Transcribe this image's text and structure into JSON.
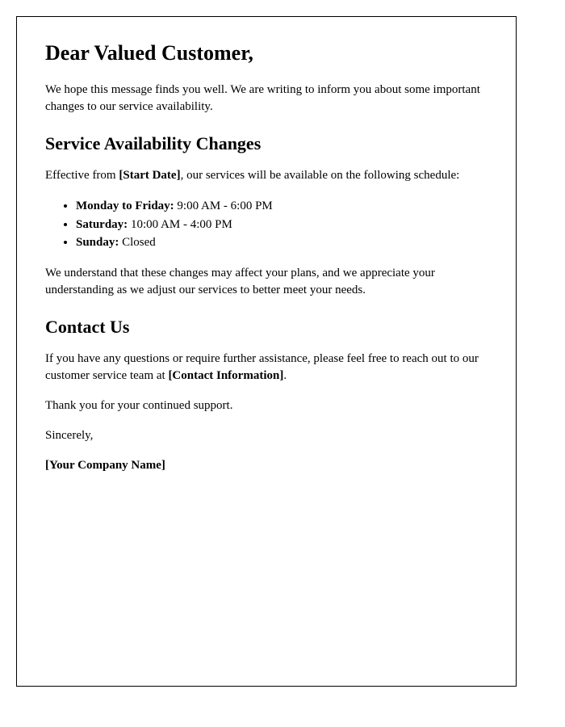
{
  "greeting": "Dear Valued Customer,",
  "intro": "We hope this message finds you well. We are writing to inform you about some important changes to our service availability.",
  "section1": {
    "heading": "Service Availability Changes",
    "effective_before": "Effective from ",
    "effective_placeholder": "[Start Date]",
    "effective_after": ", our services will be available on the following schedule:",
    "schedule": [
      {
        "label": "Monday to Friday:",
        "hours": " 9:00 AM - 6:00 PM"
      },
      {
        "label": "Saturday:",
        "hours": " 10:00 AM - 4:00 PM"
      },
      {
        "label": "Sunday:",
        "hours": " Closed"
      }
    ],
    "understanding": "We understand that these changes may affect your plans, and we appreciate your understanding as we adjust our services to better meet your needs."
  },
  "section2": {
    "heading": "Contact Us",
    "contact_before": "If you have any questions or require further assistance, please feel free to reach out to our customer service team at ",
    "contact_placeholder": "[Contact Information]",
    "contact_after": ".",
    "thanks": "Thank you for your continued support."
  },
  "signoff": "Sincerely,",
  "company": "[Your Company Name]"
}
